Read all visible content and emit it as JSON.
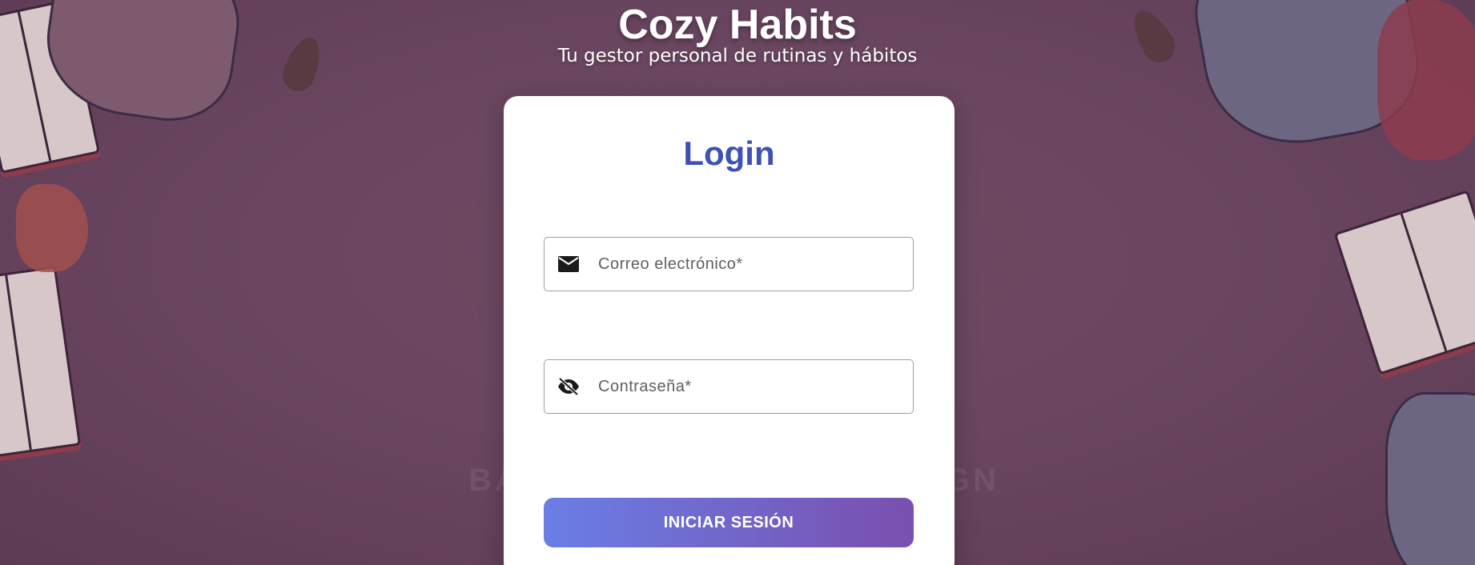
{
  "brand": {
    "title": "Cozy Habits",
    "subtitle": "Tu gestor personal de rutinas y hábitos"
  },
  "login": {
    "title": "Login",
    "email": {
      "placeholder": "Correo electrónico*",
      "value": "",
      "icon": "mail-icon"
    },
    "password": {
      "placeholder": "Contraseña*",
      "value": "",
      "icon": "visibility-off-icon"
    },
    "submit_label": "INICIAR SESIÓN"
  },
  "colors": {
    "accent": "#3f51b5",
    "button_gradient_start": "#6a7ee6",
    "button_gradient_end": "#7a4fae",
    "background": "#6a4660"
  }
}
